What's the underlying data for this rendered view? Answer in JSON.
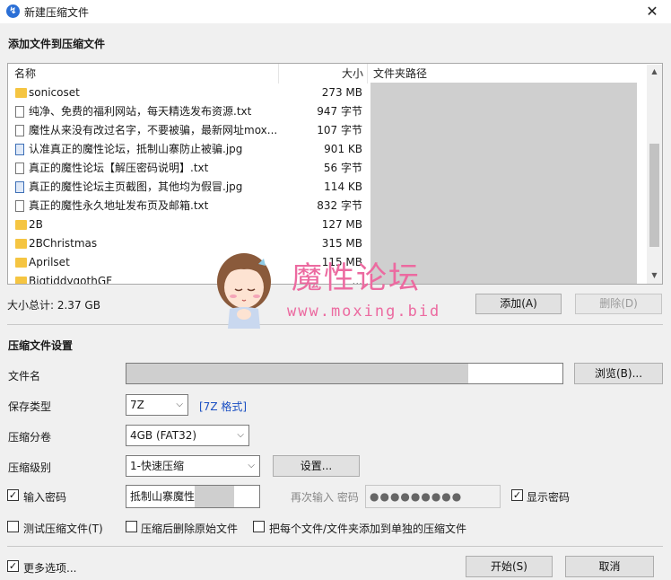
{
  "window": {
    "title": "新建压缩文件",
    "close_glyph": "✕",
    "app_icon_glyph": "↯"
  },
  "add_section": {
    "title": "添加文件到压缩文件"
  },
  "filelist": {
    "headers": {
      "name": "名称",
      "size": "大小",
      "path": "文件夹路径"
    },
    "rows": [
      {
        "icon": "folder",
        "name": "sonicoset",
        "size": "273 MB"
      },
      {
        "icon": "txt",
        "name": "纯净、免费的福利网站，每天精选发布资源.txt",
        "size": "947 字节"
      },
      {
        "icon": "txt",
        "name": "魔性从来没有改过名字，不要被骗，最新网址mox...",
        "size": "107 字节"
      },
      {
        "icon": "jpg",
        "name": "认准真正的魔性论坛，抵制山寨防止被骗.jpg",
        "size": "901 KB"
      },
      {
        "icon": "txt",
        "name": "真正的魔性论坛【解压密码说明】.txt",
        "size": "56 字节"
      },
      {
        "icon": "jpg",
        "name": "真正的魔性论坛主页截图，其他均为假冒.jpg",
        "size": "114 KB"
      },
      {
        "icon": "txt",
        "name": "真正的魔性永久地址发布页及邮箱.txt",
        "size": "832 字节"
      },
      {
        "icon": "folder",
        "name": "2B",
        "size": "127 MB"
      },
      {
        "icon": "folder",
        "name": "2BChristmas",
        "size": "315 MB"
      },
      {
        "icon": "folder",
        "name": "Aprilset",
        "size": "115 MB"
      },
      {
        "icon": "folder",
        "name": "BigtiddygothGF",
        "size": "..."
      }
    ],
    "total_label": "大小总计: 2.37 GB"
  },
  "buttons": {
    "add": "添加(A)",
    "remove": "删除(D)",
    "browse": "浏览(B)...",
    "settings": "设置...",
    "start": "开始(S)",
    "cancel": "取消"
  },
  "settings_section": {
    "title": "压缩文件设置",
    "filename_label": "文件名",
    "type_label": "保存类型",
    "type_value": "7Z",
    "type_link": "[7Z 格式]",
    "volume_label": "压缩分卷",
    "volume_value": "4GB (FAT32)",
    "level_label": "压缩级别",
    "level_value": "1-快速压缩",
    "password_label": "输入密码",
    "password_value": "抵制山寨魔性",
    "password_repeat_label": "再次输入 密码",
    "password_dots": "●●●●●●●●●",
    "show_password_label": "显示密码",
    "test_label": "测试压缩文件(T)",
    "delete_label": "压缩后删除原始文件",
    "separate_label": "把每个文件/文件夹添加到单独的压缩文件",
    "more_label": "更多选项..."
  },
  "watermark": {
    "title": "魔性论坛",
    "url": "www.moxing.bid"
  },
  "check_glyph": "✓",
  "caret_glyph": "⌵",
  "scroll_up": "▲",
  "scroll_down": "▼"
}
